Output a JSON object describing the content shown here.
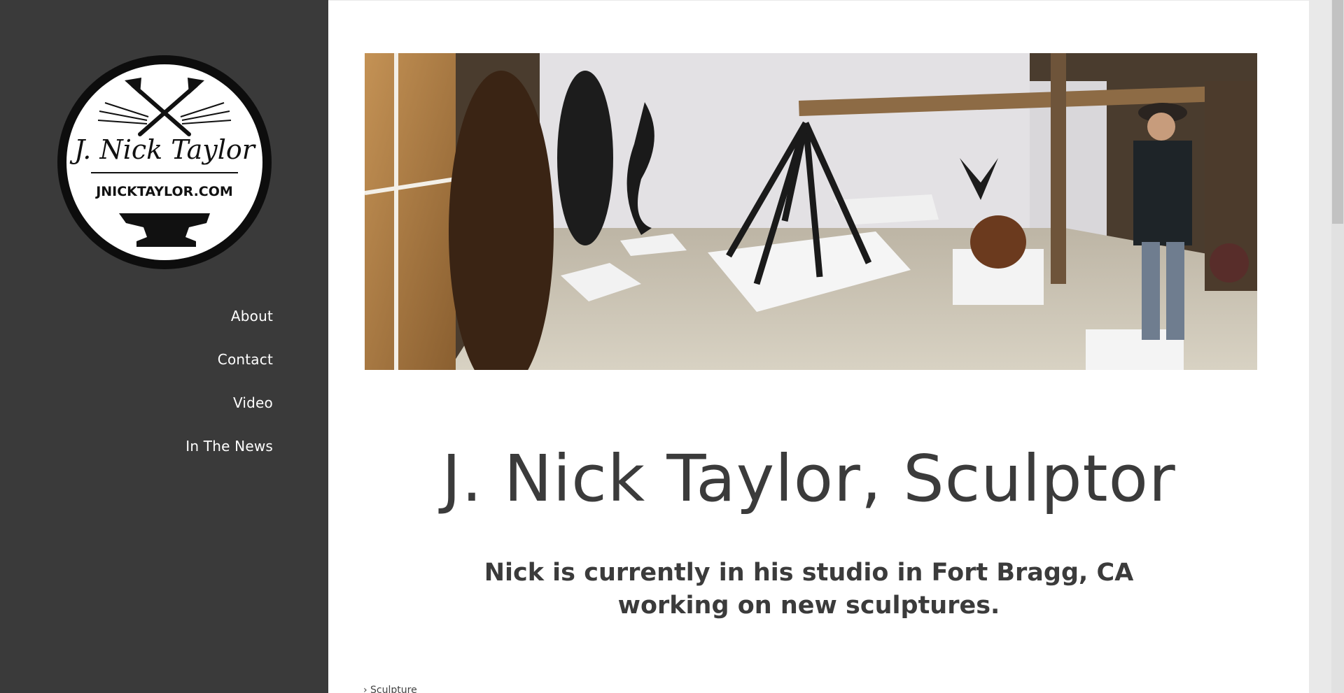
{
  "sidebar": {
    "logo": {
      "name": "J. Nick Taylor",
      "url_text": "JNICKTAYLOR.COM"
    },
    "nav": [
      {
        "label": "About"
      },
      {
        "label": "Contact"
      },
      {
        "label": "Video"
      },
      {
        "label": "In The News"
      }
    ]
  },
  "main": {
    "title": "J. Nick Taylor, Sculptor",
    "subtitle": "Nick is currently in his studio in Fort Bragg, CA working on new sculptures.",
    "breadcrumb": "› Sculpture"
  },
  "colors": {
    "sidebar_bg": "#3a3a3a",
    "text_dark": "#3b3b3b",
    "nav_text": "#ffffff"
  }
}
